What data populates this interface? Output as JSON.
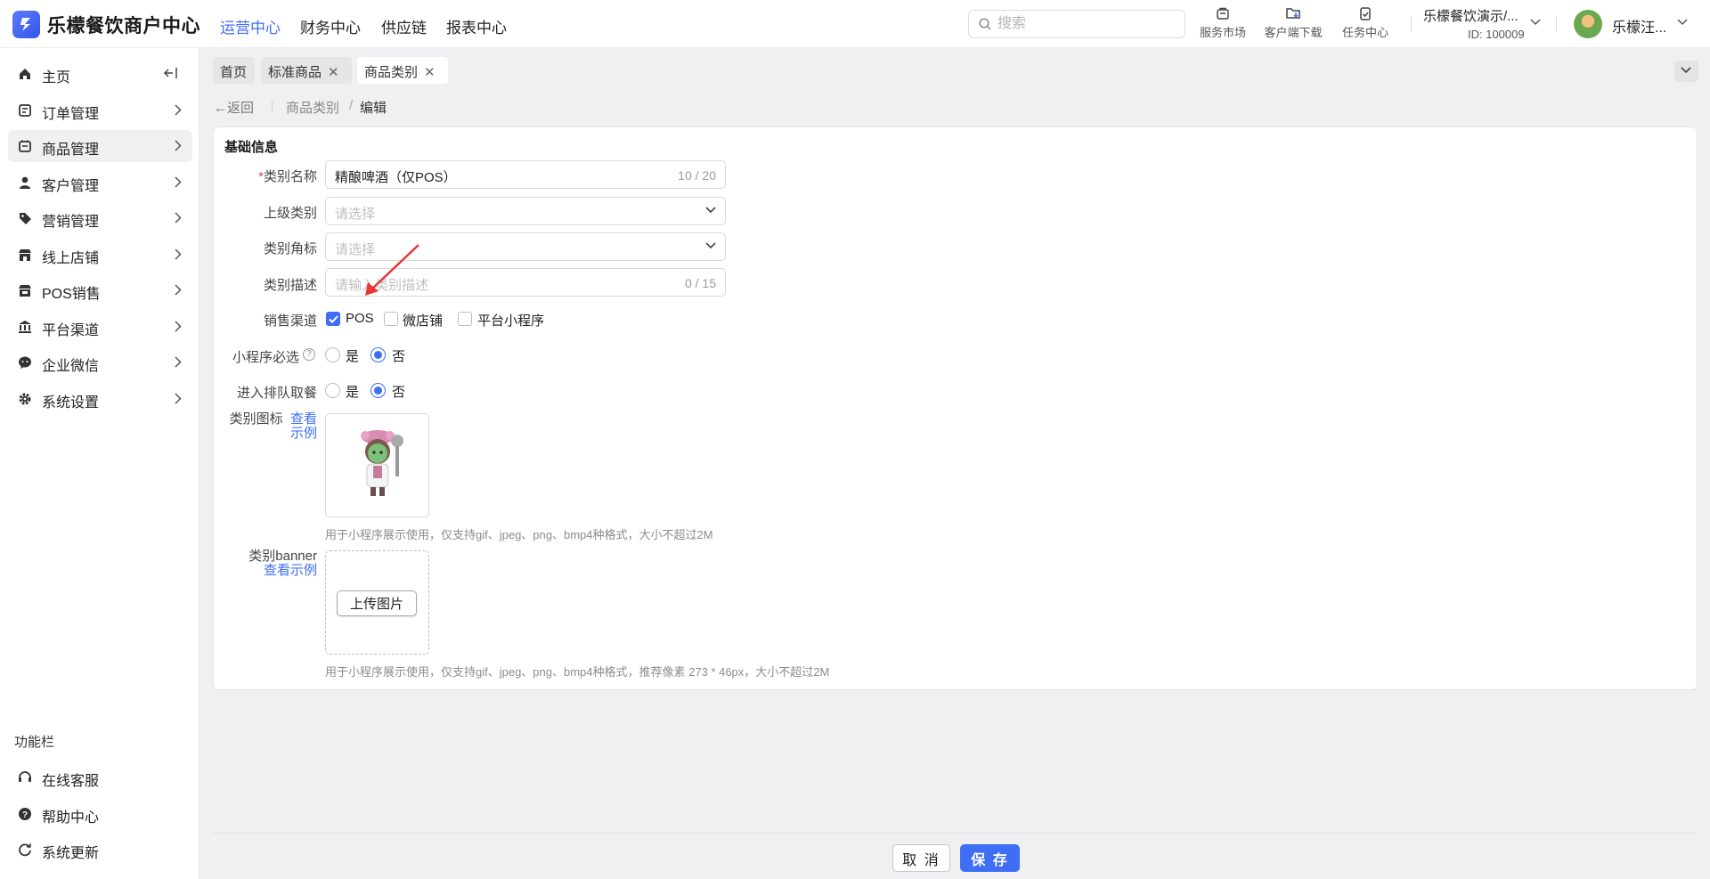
{
  "app": {
    "title": "乐檬餐饮商户中心",
    "brand_color": "#3d6ef5"
  },
  "topnav": [
    {
      "label": "运营中心",
      "active": true
    },
    {
      "label": "财务中心",
      "active": false
    },
    {
      "label": "供应链",
      "active": false
    },
    {
      "label": "报表中心",
      "active": false
    }
  ],
  "search": {
    "placeholder": "搜索"
  },
  "tools": [
    {
      "label": "服务市场",
      "icon": "bag-icon"
    },
    {
      "label": "客户端下载",
      "icon": "download-folder-icon"
    },
    {
      "label": "任务中心",
      "icon": "clipboard-check-icon"
    }
  ],
  "store": {
    "name": "乐檬餐饮演示/...",
    "id": "ID: 100009"
  },
  "user": {
    "name": "乐檬汪..."
  },
  "sidebar": {
    "items": [
      {
        "label": "主页",
        "icon": "home-icon"
      },
      {
        "label": "订单管理",
        "icon": "order-icon"
      },
      {
        "label": "商品管理",
        "icon": "goods-icon",
        "active": true
      },
      {
        "label": "客户管理",
        "icon": "user-icon"
      },
      {
        "label": "营销管理",
        "icon": "tag-icon"
      },
      {
        "label": "线上店铺",
        "icon": "store-icon"
      },
      {
        "label": "POS销售",
        "icon": "pos-icon"
      },
      {
        "label": "平台渠道",
        "icon": "bank-icon"
      },
      {
        "label": "企业微信",
        "icon": "wechat-icon"
      },
      {
        "label": "系统设置",
        "icon": "gear-icon"
      }
    ],
    "function_title": "功能栏",
    "functions": [
      {
        "label": "在线客服",
        "icon": "headset-icon"
      },
      {
        "label": "帮助中心",
        "icon": "help-icon"
      },
      {
        "label": "系统更新",
        "icon": "refresh-icon"
      }
    ]
  },
  "tabs": [
    {
      "label": "首页",
      "closable": false
    },
    {
      "label": "标准商品",
      "closable": true
    },
    {
      "label": "商品类别",
      "closable": true,
      "active": true
    }
  ],
  "breadcrumb": {
    "back": "返回",
    "parent": "商品类别",
    "separator": "/",
    "current": "编辑"
  },
  "form": {
    "section_title": "基础信息",
    "name": {
      "label": "类别名称",
      "required_mark": "*",
      "value": "精酿啤酒（仅POS）",
      "counter": "10 / 20"
    },
    "parent": {
      "label": "上级类别",
      "placeholder": "请选择"
    },
    "corner": {
      "label": "类别角标",
      "placeholder": "请选择"
    },
    "desc": {
      "label": "类别描述",
      "placeholder": "请输入类别描述",
      "counter": "0 / 15"
    },
    "channels": {
      "label": "销售渠道",
      "options": [
        {
          "label": "POS",
          "checked": true
        },
        {
          "label": "微店铺",
          "checked": false
        },
        {
          "label": "平台小程序",
          "checked": false
        }
      ]
    },
    "mini_required": {
      "label": "小程序必选",
      "help": "?",
      "yes": "是",
      "no": "否",
      "selected": "否"
    },
    "queue": {
      "label": "进入排队取餐",
      "yes": "是",
      "no": "否",
      "selected": "否"
    },
    "icon": {
      "label": "类别图标",
      "link": "查看示例",
      "hint": "用于小程序展示使用，仅支持gif、jpeg、png、bmp4种格式，大小不超过2M"
    },
    "banner": {
      "label": "类别banner",
      "link": "查看示例",
      "upload": "上传图片",
      "hint": "用于小程序展示使用，仅支持gif、jpeg、png、bmp4种格式，推荐像素 273 * 46px，大小不超过2M"
    }
  },
  "actions": {
    "cancel": "取 消",
    "save": "保 存"
  }
}
